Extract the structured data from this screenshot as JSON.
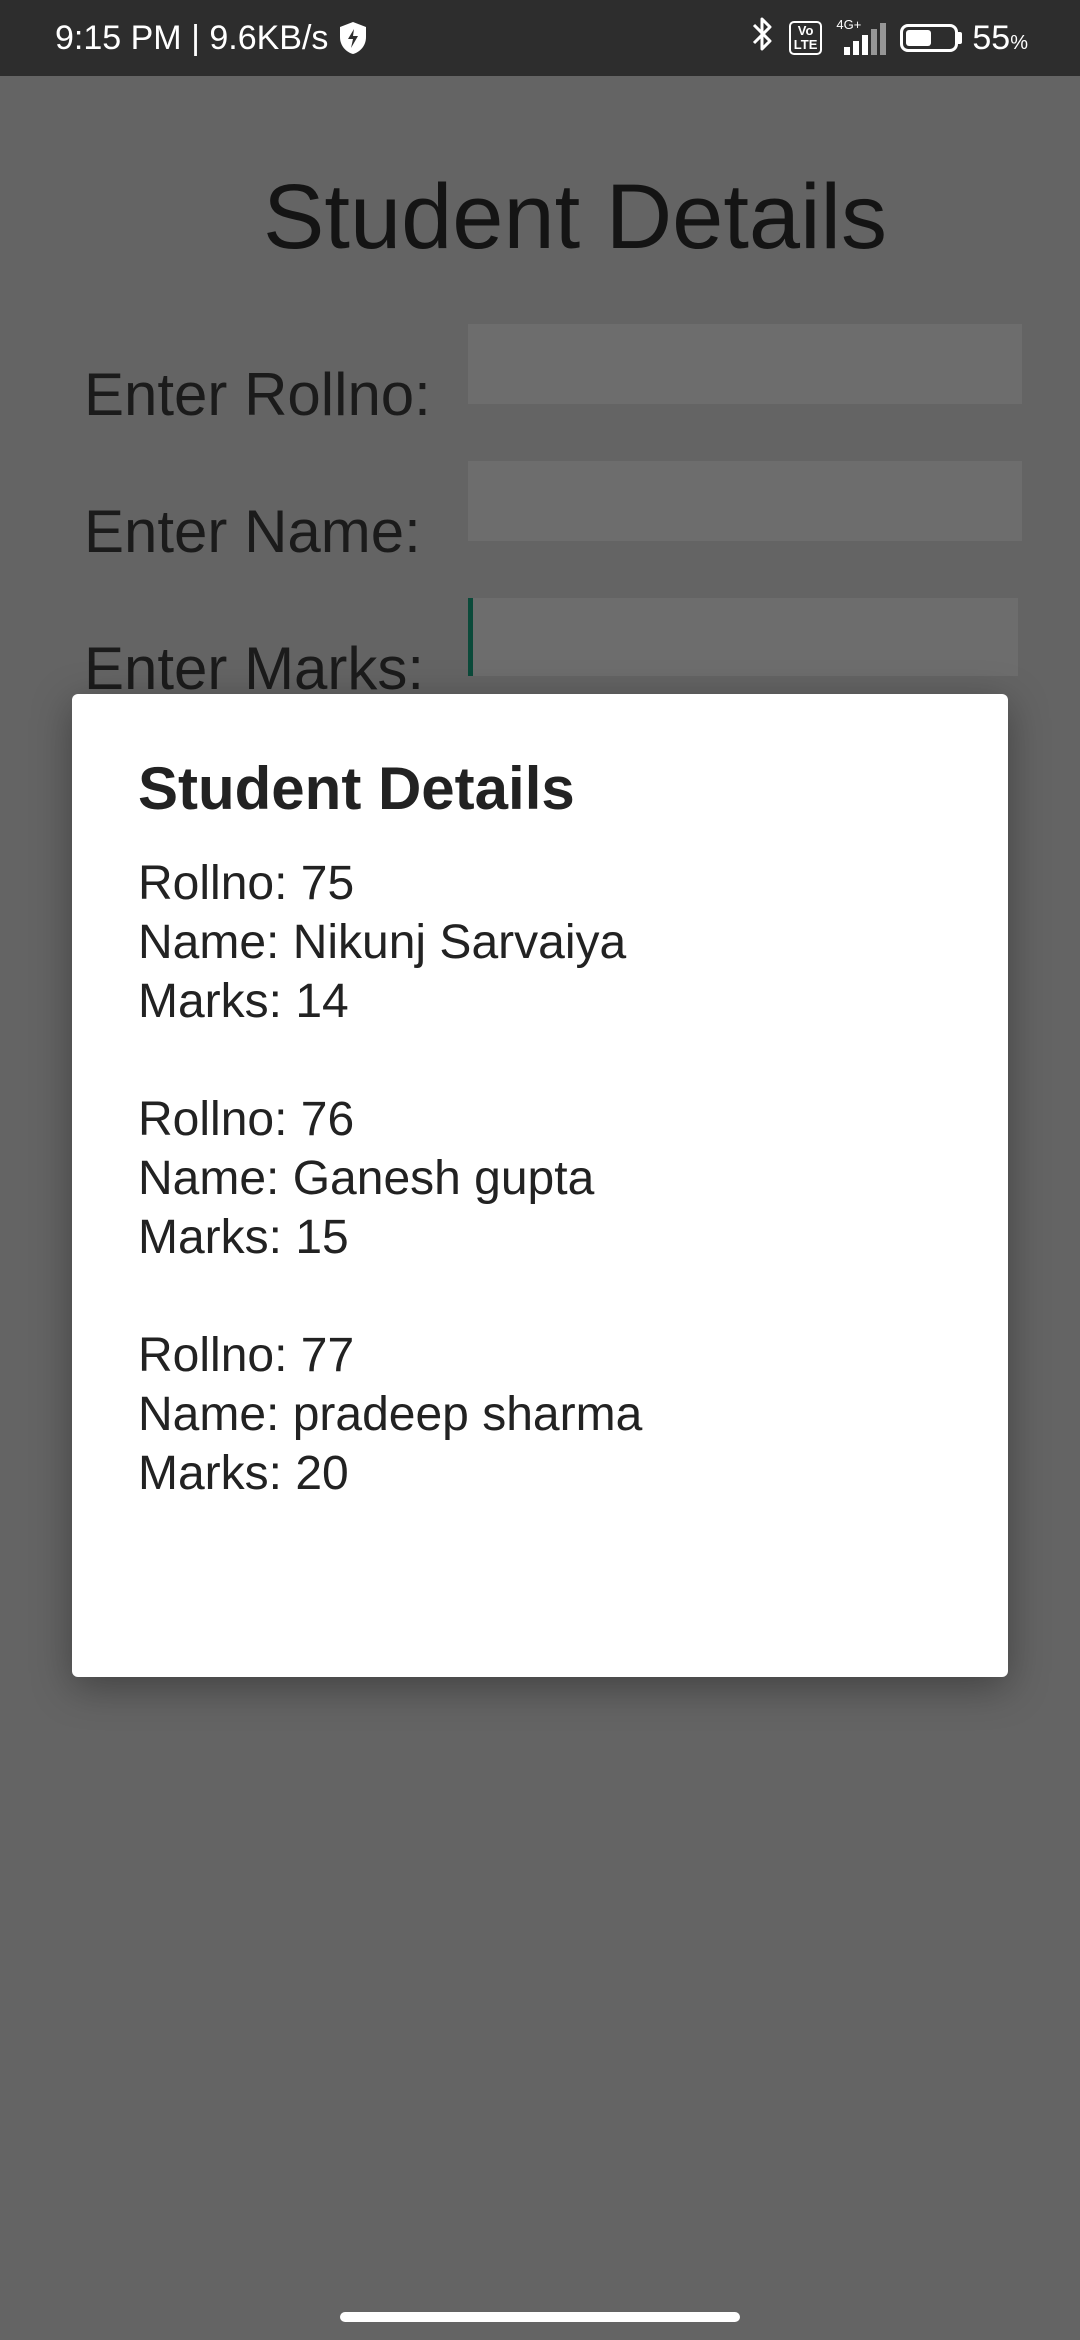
{
  "status_bar": {
    "time_speed": "9:15 PM | 9.6KB/s",
    "volte": "Vo\nLTE",
    "network_gen": "4G+",
    "battery_level": 0.55,
    "battery_percent": "55",
    "battery_unit": "%",
    "icons": [
      "shield-icon",
      "bluetooth-icon",
      "volte-icon",
      "signal-icon",
      "battery-icon"
    ]
  },
  "app": {
    "title": "Student Details",
    "labels": {
      "rollno": "Enter Rollno:",
      "name": "Enter Name:",
      "marks": "Enter Marks:"
    },
    "inputs": {
      "rollno": "",
      "name": "",
      "marks": ""
    }
  },
  "dialog": {
    "title": "Student Details",
    "records": [
      {
        "rollno": "Rollno: 75",
        "name": "Name: Nikunj Sarvaiya",
        "marks": "Marks: 14"
      },
      {
        "rollno": "Rollno: 76",
        "name": "Name: Ganesh gupta",
        "marks": "Marks: 15"
      },
      {
        "rollno": "Rollno: 77",
        "name": "Name: pradeep sharma",
        "marks": "Marks: 20"
      }
    ]
  },
  "colors": {
    "scrim": "#646464",
    "status_bar": "#2d2d2d",
    "dialog_bg": "#ffffff",
    "accent_cursor": "#0b4a3a"
  }
}
